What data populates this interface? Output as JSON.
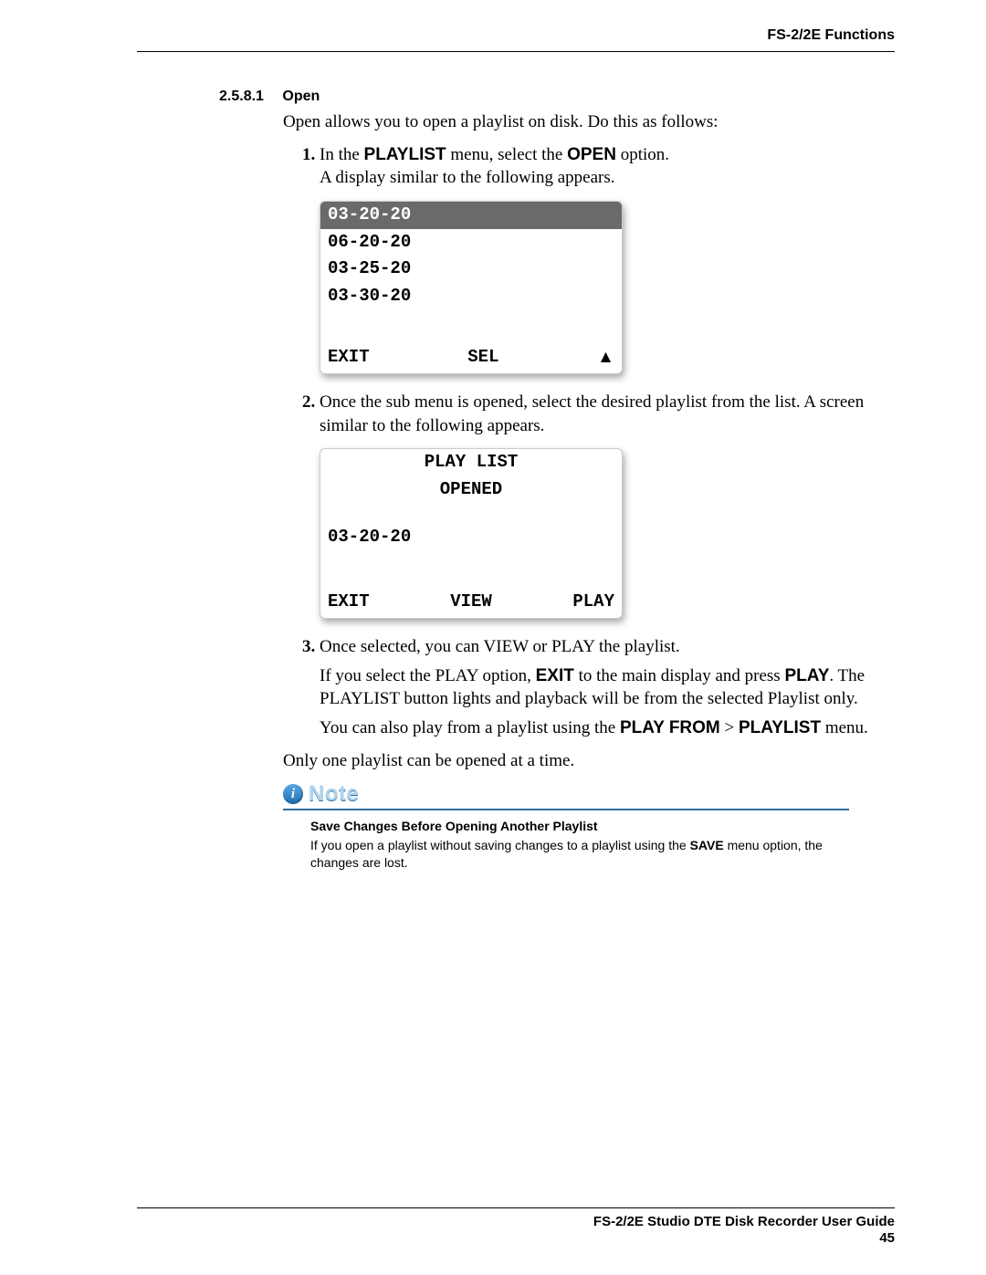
{
  "header": {
    "section": "FS-2/2E Functions"
  },
  "section": {
    "number": "2.5.8.1",
    "title": "Open"
  },
  "intro": "Open allows you to open a playlist on disk. Do this as follows:",
  "steps": {
    "s1": {
      "p1a": "In the ",
      "b1": "PLAYLIST",
      "p1b": " menu, select the ",
      "b2": "OPEN",
      "p1c": " option.",
      "p2": "A display similar to the following appears."
    },
    "s2": {
      "p1": "Once the sub menu is opened, select the desired playlist from the list. A screen similar to the following appears."
    },
    "s3": {
      "p1": "Once selected, you can VIEW or PLAY the playlist.",
      "p2a": "If you select the PLAY option, ",
      "b1": "EXIT",
      "p2b": " to the main display and press ",
      "b2": "PLAY",
      "p2c": ". The PLAYLIST button lights and playback will be from the selected Playlist only.",
      "p3a": "You can also play from a playlist using the ",
      "b3": "PLAY FROM",
      "gt": " > ",
      "b4": "PLAYLIST",
      "p3b": " menu."
    }
  },
  "lcd1": {
    "rows": [
      "03-20-20",
      "06-20-20",
      "03-25-20",
      "03-30-20"
    ],
    "btn1": "EXIT",
    "btn2": "SEL",
    "btn3": "▲"
  },
  "lcd2": {
    "title1": "PLAY LIST",
    "title2": "OPENED",
    "name": "03-20-20",
    "btn1": "EXIT",
    "btn2": "VIEW",
    "btn3": "PLAY"
  },
  "closing": "Only one playlist can be opened at a time.",
  "note": {
    "label": "Note",
    "title": "Save Changes Before Opening Another Playlist",
    "body_a": "If you open a playlist without saving changes to a playlist using the ",
    "body_b": "SAVE",
    "body_c": " menu option, the changes are lost."
  },
  "footer": {
    "line1": "FS-2/2E Studio DTE Disk Recorder User Guide",
    "page": "45"
  }
}
